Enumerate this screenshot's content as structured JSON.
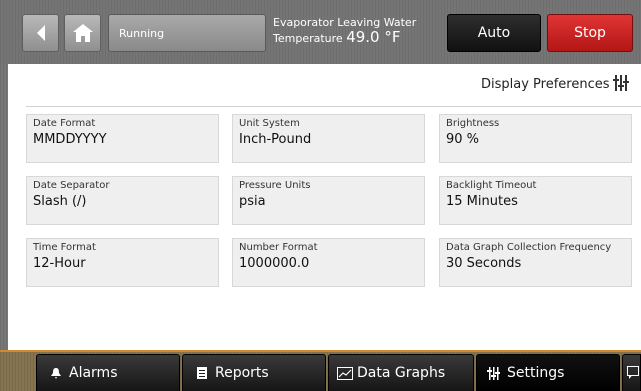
{
  "header": {
    "back_icon": "arrow-left-icon",
    "home_icon": "home-icon",
    "status": "Running",
    "temp_label_line1": "Evaporator Leaving Water",
    "temp_label_line2": "Temperature",
    "temp_value": "49.0 °F",
    "auto_label": "Auto",
    "stop_label": "Stop"
  },
  "panel": {
    "title": "Display Preferences",
    "icon": "sliders-icon"
  },
  "settings": [
    {
      "label": "Date Format",
      "value": "MMDDYYYY"
    },
    {
      "label": "Unit System",
      "value": "Inch-Pound"
    },
    {
      "label": "Brightness",
      "value": "90 %"
    },
    {
      "label": "Date Separator",
      "value": "Slash (/)"
    },
    {
      "label": "Pressure Units",
      "value": "psia"
    },
    {
      "label": "Backlight Timeout",
      "value": "15 Minutes"
    },
    {
      "label": "Time Format",
      "value": "12-Hour"
    },
    {
      "label": "Number Format",
      "value": "1000000.0"
    },
    {
      "label": "Data Graph Collection Frequency",
      "value": "30 Seconds"
    }
  ],
  "nav": {
    "tabs": [
      {
        "label": "Alarms",
        "icon": "bell-icon"
      },
      {
        "label": "Reports",
        "icon": "document-icon"
      },
      {
        "label": "Data Graphs",
        "icon": "chart-icon"
      },
      {
        "label": "Settings",
        "icon": "sliders-icon"
      }
    ],
    "active": "Settings"
  },
  "colors": {
    "stop": "#c81e1e",
    "accent_bar": "#d28a2a"
  }
}
